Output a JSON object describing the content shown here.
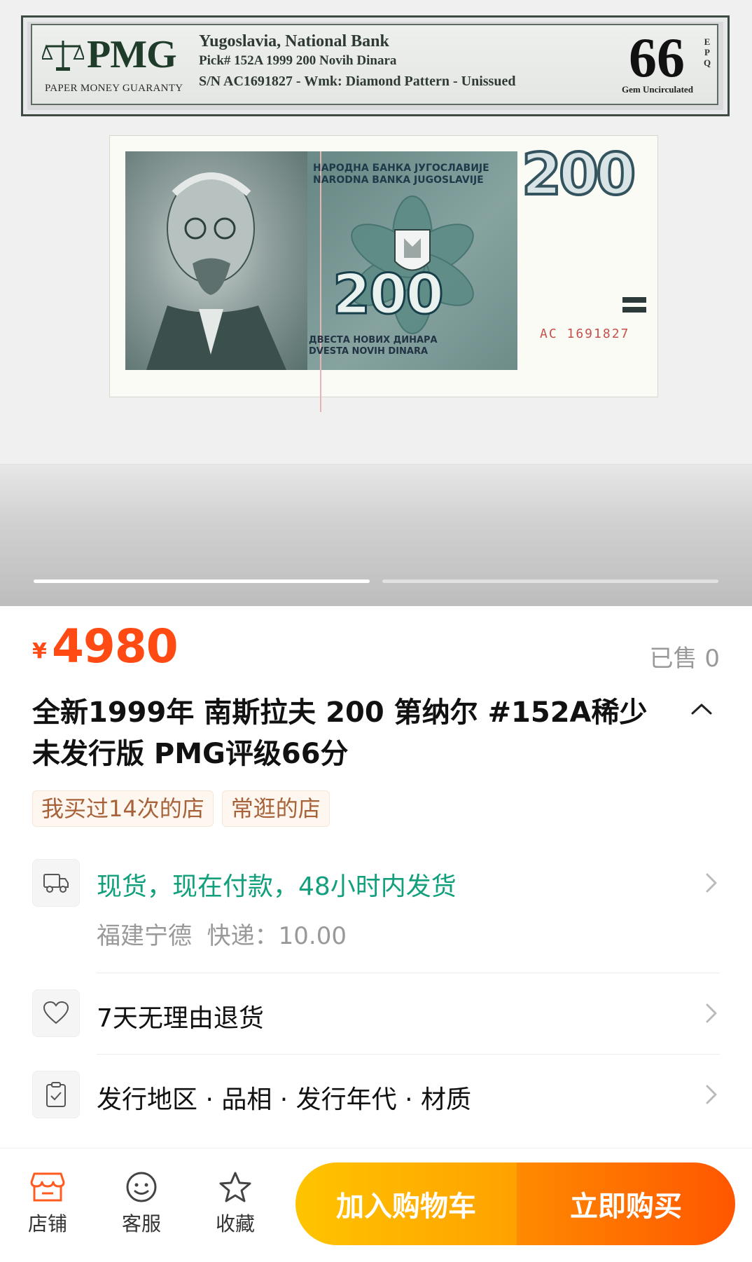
{
  "gallery": {
    "holder": {
      "brand": "PMG",
      "guarantee": "PAPER MONEY GUARANTY",
      "line1": "Yugoslavia, National Bank",
      "line2": "Pick# 152A  1999  200 Novih Dinara",
      "line3": "S/N AC1691827 - Wmk: Diamond Pattern - Unissued",
      "grade": "66",
      "grade_suffix": "EPQ",
      "grade_desc": "Gem Uncirculated"
    },
    "banknote": {
      "bank_cyrillic": "НАРОДНА БАНКА ЈУГОСЛАВИЈЕ",
      "bank_latin": "NARODNA BANKA JUGOSLAVIJE",
      "denomination": "200",
      "corner_denomination": "200",
      "words_cyrillic": "ДВЕСТА НОВИХ ДИНАРА",
      "words_latin": "DVESTA NOVIH DINARA",
      "serial": "AC 1691827"
    },
    "pages_total": 2,
    "current_page": 1
  },
  "product": {
    "currency_symbol": "¥",
    "price": "4980",
    "sold_text": "已售 0",
    "title": "全新1999年 南斯拉夫 200 第纳尔 #152A稀少未发行版 PMG评级66分",
    "tags": [
      "我买过14次的店",
      "常逛的店"
    ]
  },
  "shipping": {
    "status": "现货，现在付款，48小时内发货",
    "origin": "福建宁德",
    "fee": "快递：10.00"
  },
  "returns": {
    "label": "7天无理由退货"
  },
  "params": {
    "label": "发行地区 · 品相 · 发行年代 · 材质"
  },
  "bottom_bar": {
    "shop": "店铺",
    "service": "客服",
    "favorite": "收藏",
    "add_to_cart": "加入购物车",
    "buy_now": "立即购买"
  },
  "colors": {
    "price": "#ff4a13",
    "green": "#12a07c",
    "cart_button": "#ffb300",
    "buy_button": "#ff6a00"
  }
}
